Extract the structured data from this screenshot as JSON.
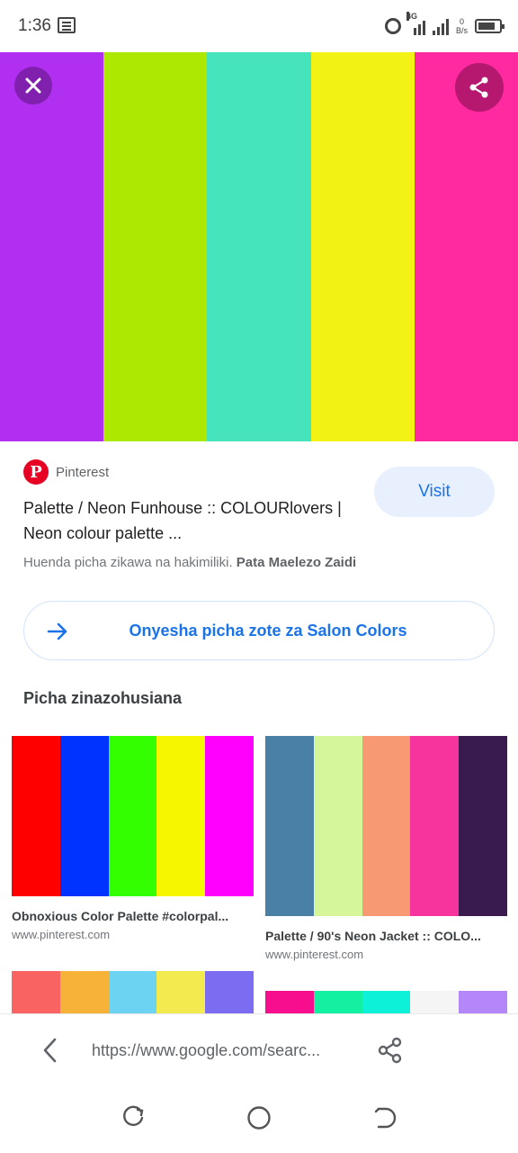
{
  "status": {
    "time": "1:36",
    "network": "4G",
    "speed_value": "0",
    "speed_unit": "B/s"
  },
  "hero": {
    "colors": [
      "#b12ff0",
      "#ade802",
      "#45e4bd",
      "#f2f214",
      "#ff2a9f"
    ]
  },
  "result": {
    "source": "Pinterest",
    "title": "Palette / Neon Funhouse :: COLOURlovers | Neon colour palette ...",
    "visit_label": "Visit",
    "copyright_text": "Huenda picha zikawa na hakimiliki.",
    "learn_more": "Pata Maelezo Zaidi"
  },
  "all_images": {
    "label": "Onyesha picha zote za Salon Colors"
  },
  "related": {
    "heading": "Picha zinazohusiana",
    "cards": [
      {
        "title": "Obnoxious Color Palette #colorpal...",
        "domain": "www.pinterest.com",
        "colors": [
          "#ff0000",
          "#0033ff",
          "#33ff00",
          "#f6f600",
          "#ff00ff"
        ]
      },
      {
        "title": "Palette / 90's Neon Jacket :: COLO...",
        "domain": "www.pinterest.com",
        "colors": [
          "#4a7fa6",
          "#d6f799",
          "#f79a73",
          "#f7349e",
          "#3a1b4f"
        ]
      },
      {
        "title": "",
        "domain": "",
        "colors": [
          "#f96462",
          "#f7b23a",
          "#6dd3f2",
          "#f2ea4e",
          "#7c6cf2"
        ]
      },
      {
        "title": "",
        "domain": "",
        "colors": [
          "#f70e8f",
          "#13f0a1",
          "#0ef1d9",
          "#f5f5f5",
          "#b387f7"
        ]
      }
    ]
  },
  "browser": {
    "url": "https://www.google.com/searc..."
  },
  "accent": "#1a73e8"
}
